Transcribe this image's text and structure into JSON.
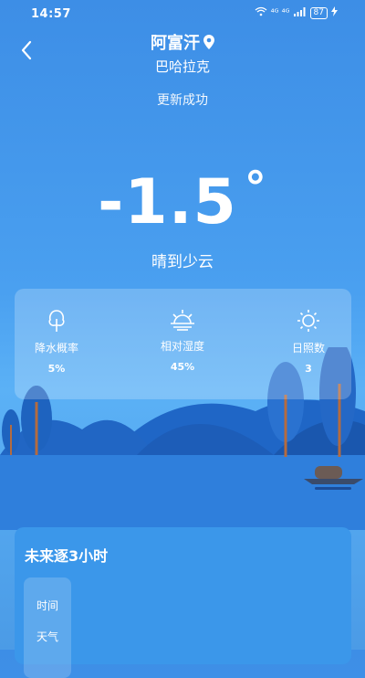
{
  "status": {
    "time": "14:57",
    "signal": "⁴ᴳ ⁴ᴳ",
    "battery": "87"
  },
  "header": {
    "city": "阿富汗",
    "district": "巴哈拉克",
    "update_status": "更新成功"
  },
  "current": {
    "temperature": "-1.5",
    "degree": "°",
    "condition": "晴到少云"
  },
  "metrics": [
    {
      "label": "降水概率",
      "value": "5%",
      "icon": "tree-icon"
    },
    {
      "label": "相对湿度",
      "value": "45%",
      "icon": "sunrise-icon"
    },
    {
      "label": "日照数",
      "value": "3",
      "icon": "sun-icon"
    }
  ],
  "forecast": {
    "title": "未来逐3小时",
    "rows": [
      "时间",
      "天气"
    ]
  }
}
